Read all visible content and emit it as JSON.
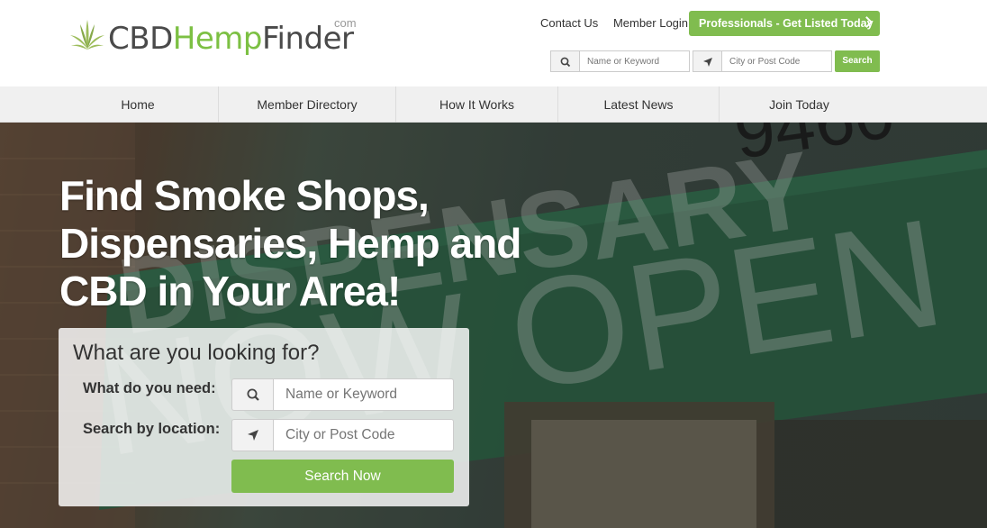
{
  "logo": {
    "part1": "CBD",
    "part2": "Hemp",
    "part3": "Finder",
    "suffix": "com"
  },
  "top_links": {
    "contact": "Contact Us",
    "login": "Member Login"
  },
  "pro_button": "Professionals - Get Listed Today",
  "mini_search": {
    "keyword_placeholder": "Name or Keyword",
    "location_placeholder": "City or Post Code",
    "button": "Search"
  },
  "nav": [
    "Home",
    "Member Directory",
    "How It Works",
    "Latest News",
    "Join Today"
  ],
  "hero": {
    "title": "Find Smoke Shops, Dispensaries, Hemp and CBD in Your Area!",
    "sign_word_1": "DISPENSARY",
    "sign_word_2": "NOW OPEN",
    "address": "9460"
  },
  "search_panel": {
    "title": "What are you looking for?",
    "need_label": "What do you need:",
    "need_placeholder": "Name or Keyword",
    "location_label": "Search by location:",
    "location_placeholder": "City or Post Code",
    "button": "Search Now"
  },
  "colors": {
    "brand_green": "#80bc4f",
    "logo_green": "#7cc043"
  }
}
